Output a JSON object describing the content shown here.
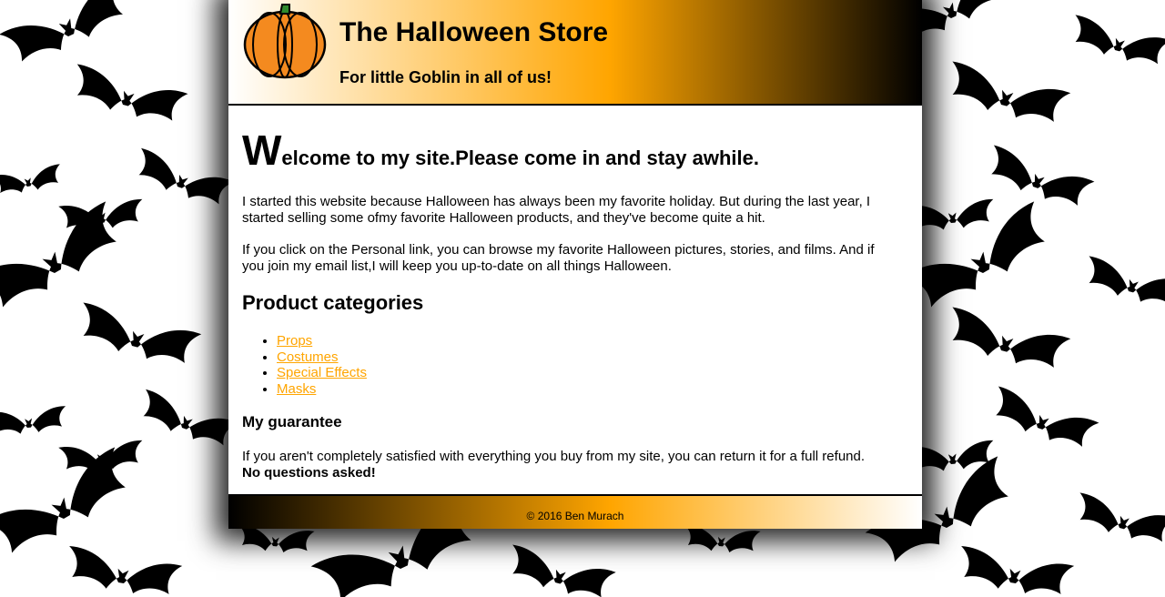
{
  "header": {
    "logo_icon": "pumpkin-icon",
    "title": "The Halloween Store",
    "tagline": "For little Goblin in all of us!"
  },
  "main": {
    "welcome_initial": "W",
    "welcome_rest": "elcome to my site.Please come in and stay awhile.",
    "intro_1": "I started this website because Halloween has always been my favorite holiday. But during the last year, I started selling some ofmy favorite Halloween products, and they've become quite a hit.",
    "intro_2": "If you click on the Personal link, you can browse my favorite Halloween pictures, stories, and films. And if you join my email list,I will keep you up-to-date on all things Halloween.",
    "categories_heading": "Product categories",
    "categories": [
      {
        "label": "Props"
      },
      {
        "label": "Costumes"
      },
      {
        "label": "Special Effects"
      },
      {
        "label": "Masks"
      }
    ],
    "guarantee_heading": "My guarantee",
    "guarantee_text": "If you aren't completely satisfied with everything you buy from my site, you can return it for a full refund.",
    "guarantee_bold": "No questions asked!"
  },
  "footer": {
    "copyright": "© 2016 Ben Murach"
  },
  "colors": {
    "accent": "#ffa500",
    "text": "#000000",
    "background": "#ffffff"
  },
  "background_pattern": "bat-icon"
}
